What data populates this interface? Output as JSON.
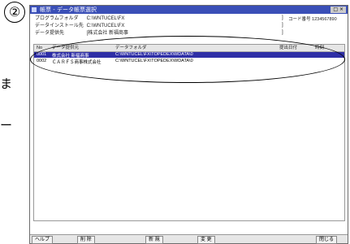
{
  "annotation": {
    "marker": "②",
    "side_text_1": "ま",
    "side_text_2": "ー"
  },
  "window": {
    "title": "帳票 - データ帳票選択",
    "buttons": "□ ×"
  },
  "info": {
    "rows": [
      {
        "label": "プログラムフォルダ",
        "value": "C:\\WNTUCEL\\FX"
      },
      {
        "label": "データインストール先",
        "value": "C:\\WNTUCEL\\FX"
      },
      {
        "label": "データ提供先",
        "value": "[株式会社 新福商事"
      }
    ],
    "code_label": "コード番号",
    "code_value": "1234567890"
  },
  "table": {
    "headers": [
      "No",
      "データ提供元",
      "データフォルダ",
      "提出日付",
      "時刻"
    ],
    "rows": [
      {
        "no": "0001",
        "name": "株式会社 新福商事",
        "folder": "C:\\WNTUCEL\\FX\\TOPEDEX\\WDATA\\0",
        "selected": true
      },
      {
        "no": "0002",
        "name": "ＣＡＲＦＳ商事株式会社",
        "folder": "C:\\WNTUCEL\\FX\\TOPEDEX\\WDATA\\0",
        "selected": false
      }
    ]
  },
  "fkeys": [
    "ヘルプ",
    "削 除",
    "新 規",
    "変 更",
    "閉じる"
  ]
}
